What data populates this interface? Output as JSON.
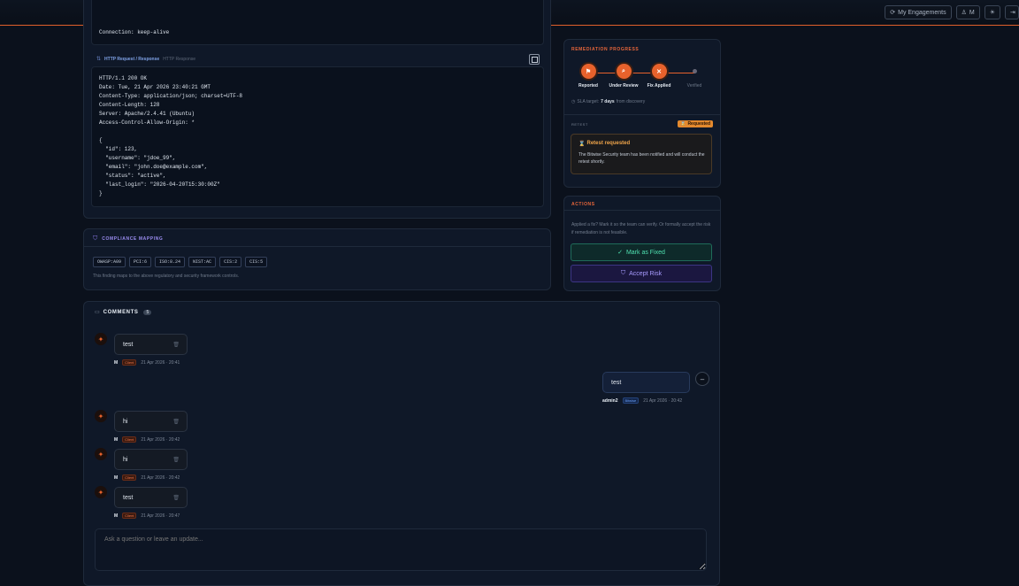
{
  "header": {
    "engagements_label": "My Engagements",
    "user_label": "M",
    "icons": [
      "refresh-icon",
      "user-icon",
      "sun-icon",
      "logout-icon"
    ]
  },
  "request": {
    "last_line": "Connection: keep-alive"
  },
  "response": {
    "title": "HTTP Request / Response",
    "subtitle": "HTTP Response",
    "lines": [
      "HTTP/1.1 200 OK",
      "Date: Tue, 21 Apr 2026 23:40:21 GMT",
      "Content-Type: application/json; charset=UTF-8",
      "Content-Length: 128",
      "Server: Apache/2.4.41 (Ubuntu)",
      "Access-Control-Allow-Origin: *",
      "",
      "{",
      "  \"id\": 123,",
      "  \"username\": \"jdoe_99\",",
      "  \"email\": \"john.doe@example.com\",",
      "  \"status\": \"active\",",
      "  \"last_login\": \"2026-04-20T15:30:00Z\"",
      "}"
    ]
  },
  "compliance": {
    "title": "COMPLIANCE MAPPING",
    "tags": [
      "OWASP:A09",
      "PCI:6",
      "ISO:8.24",
      "NIST:AC",
      "CIS:2",
      "CIS:5"
    ],
    "note": "This finding maps to the above regulatory and security framework controls."
  },
  "remediation": {
    "title": "REMEDIATION PROGRESS",
    "steps": [
      {
        "label": "Reported",
        "active": true
      },
      {
        "label": "Under Review",
        "active": true
      },
      {
        "label": "Fix Applied",
        "active": true
      },
      {
        "label": "Verified",
        "active": false
      }
    ],
    "sla_prefix": "SLA target:",
    "sla_value": "7 days",
    "sla_suffix": "from discovery"
  },
  "retest": {
    "title": "RETEST",
    "badge": "Requested",
    "box_title": "Retest requested",
    "box_text": "The Bitwise Security team has been notified and will conduct the retest shortly."
  },
  "actions": {
    "title": "ACTIONS",
    "text": "Applied a fix? Mark it so the team can verify. Or formally accept the risk if remediation is not feasible.",
    "mark_fixed": "Mark as Fixed",
    "accept_risk": "Accept Risk"
  },
  "comments": {
    "title": "COMMENTS",
    "count": "5",
    "items": [
      {
        "text": "test",
        "author": "M",
        "role": "Client",
        "time": "21 Apr 2026 · 20:41",
        "side": "left"
      },
      {
        "text": "test",
        "author": "admin2",
        "role": "Bitwise",
        "time": "21 Apr 2026 · 20:42",
        "side": "right"
      },
      {
        "text": "hi",
        "author": "M",
        "role": "Client",
        "time": "21 Apr 2026 · 20:42",
        "side": "left"
      },
      {
        "text": "hi",
        "author": "M",
        "role": "Client",
        "time": "21 Apr 2026 · 20:42",
        "side": "left"
      },
      {
        "text": "test",
        "author": "M",
        "role": "Client",
        "time": "21 Apr 2026 · 20:47",
        "side": "left"
      }
    ],
    "placeholder": "Ask a question or leave an update..."
  }
}
